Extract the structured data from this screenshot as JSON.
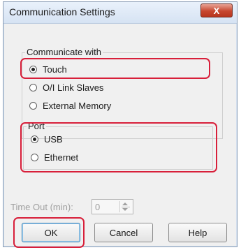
{
  "window": {
    "title": "Communication Settings",
    "close_label": "X"
  },
  "communicate_with": {
    "legend": "Communicate with",
    "options": [
      {
        "label": "Touch",
        "selected": true
      },
      {
        "label": "O/I Link Slaves",
        "selected": false
      },
      {
        "label": "External Memory",
        "selected": false
      }
    ]
  },
  "port": {
    "legend": "Port",
    "options": [
      {
        "label": "USB",
        "selected": true
      },
      {
        "label": "Ethernet",
        "selected": false
      }
    ]
  },
  "timeout": {
    "label": "Time Out (min):",
    "value": "0"
  },
  "buttons": {
    "ok": "OK",
    "cancel": "Cancel",
    "help": "Help"
  },
  "colors": {
    "highlight": "#d81f3a",
    "close_button": "#c7472f",
    "dialog_bg": "#f0f0f0"
  }
}
